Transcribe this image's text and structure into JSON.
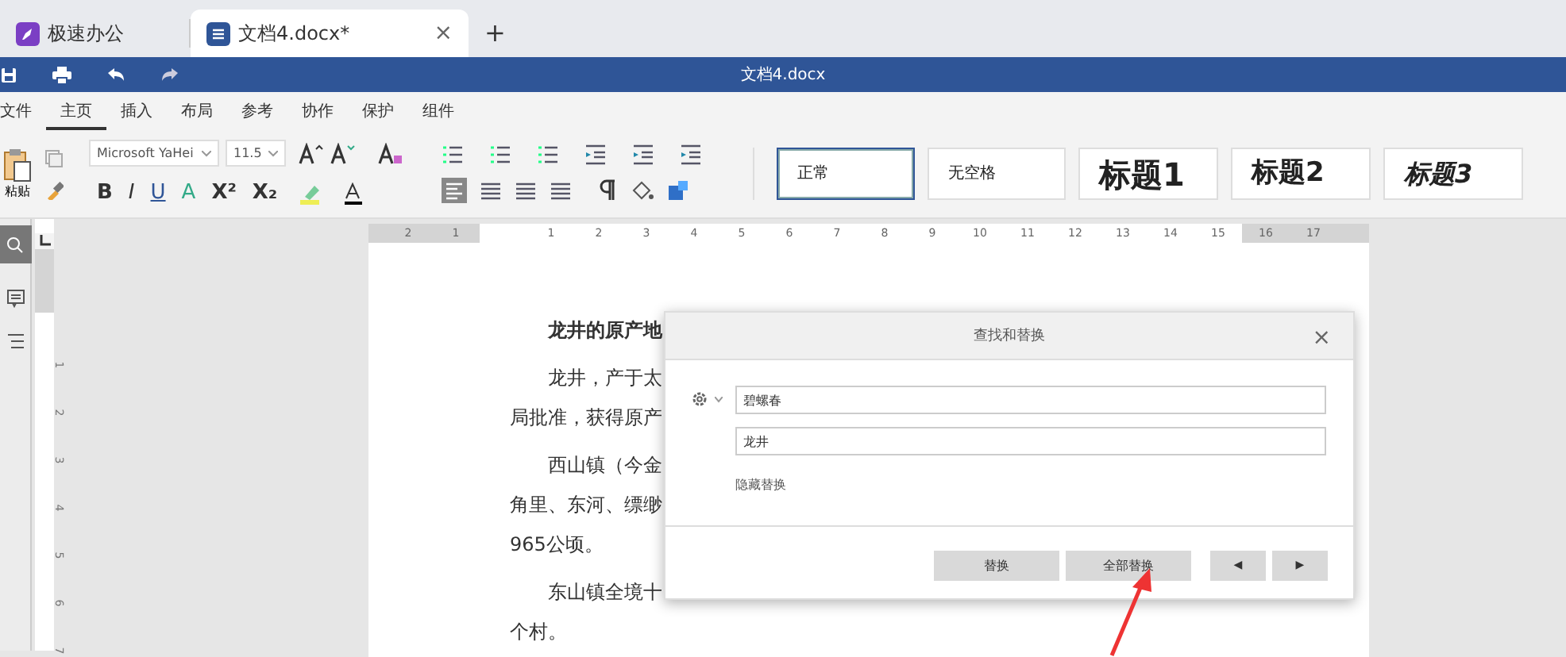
{
  "tabs": [
    {
      "label": "极速办公",
      "kind": "app",
      "selected": false
    },
    {
      "label": "文档4.docx*",
      "kind": "doc",
      "selected": true,
      "close": "×"
    }
  ],
  "new_tab": "+",
  "window": {
    "title": "文档4.docx"
  },
  "menu": [
    {
      "label": "文件",
      "selected": false
    },
    {
      "label": "主页",
      "selected": true
    },
    {
      "label": "插入",
      "selected": false
    },
    {
      "label": "布局",
      "selected": false
    },
    {
      "label": "参考",
      "selected": false
    },
    {
      "label": "协作",
      "selected": false
    },
    {
      "label": "保护",
      "selected": false
    },
    {
      "label": "组件",
      "selected": false
    }
  ],
  "toolbar": {
    "paste": "粘贴",
    "font": "Microsoft YaHei",
    "size": "11.5",
    "format_buttons": [
      {
        "label": "B",
        "kind": "bold"
      },
      {
        "label": "I",
        "kind": "italic"
      },
      {
        "label": "U",
        "kind": "underline"
      },
      {
        "label": "A",
        "kind": "strike"
      },
      {
        "label": "X²",
        "kind": "sup"
      },
      {
        "label": "X₂",
        "kind": "sub"
      }
    ]
  },
  "styles": [
    {
      "label": "正常",
      "kind": "normal",
      "selected": true
    },
    {
      "label": "无空格",
      "kind": "normal",
      "selected": false
    },
    {
      "label": "标题1",
      "kind": "h1",
      "selected": false
    },
    {
      "label": "标题2",
      "kind": "h2",
      "selected": false
    },
    {
      "label": "标题3",
      "kind": "h3",
      "selected": false
    }
  ],
  "ruler_numbers": [
    "2",
    "1",
    "1",
    "2",
    "3",
    "4",
    "5",
    "6",
    "7",
    "8",
    "9",
    "10",
    "11",
    "12",
    "13",
    "14",
    "15",
    "16",
    "17"
  ],
  "vertical_ruler_numbers": [
    "1",
    "2",
    "3",
    "4",
    "5",
    "6",
    "7"
  ],
  "document": {
    "paragraphs": [
      {
        "bold": true,
        "lines": [
          "龙井的原产地"
        ]
      },
      {
        "bold": false,
        "lines": [
          "龙井，产于太",
          "局批准，获得原产"
        ]
      },
      {
        "bold": false,
        "lines": [
          "西山镇（今金",
          "角里、东河、缥缈",
          "965公顷。"
        ]
      },
      {
        "bold": false,
        "lines": [
          "东山镇全境十",
          "个村。"
        ]
      }
    ]
  },
  "dialog": {
    "title": "查找和替换",
    "close": "×",
    "find": "碧螺春",
    "replace": "龙井",
    "toggle_link": "隐藏替换",
    "buttons": [
      {
        "label": "替换",
        "kind": "text"
      },
      {
        "label": "全部替换",
        "kind": "text"
      },
      {
        "label": "◀",
        "kind": "nav"
      },
      {
        "label": "▶",
        "kind": "nav"
      }
    ]
  }
}
